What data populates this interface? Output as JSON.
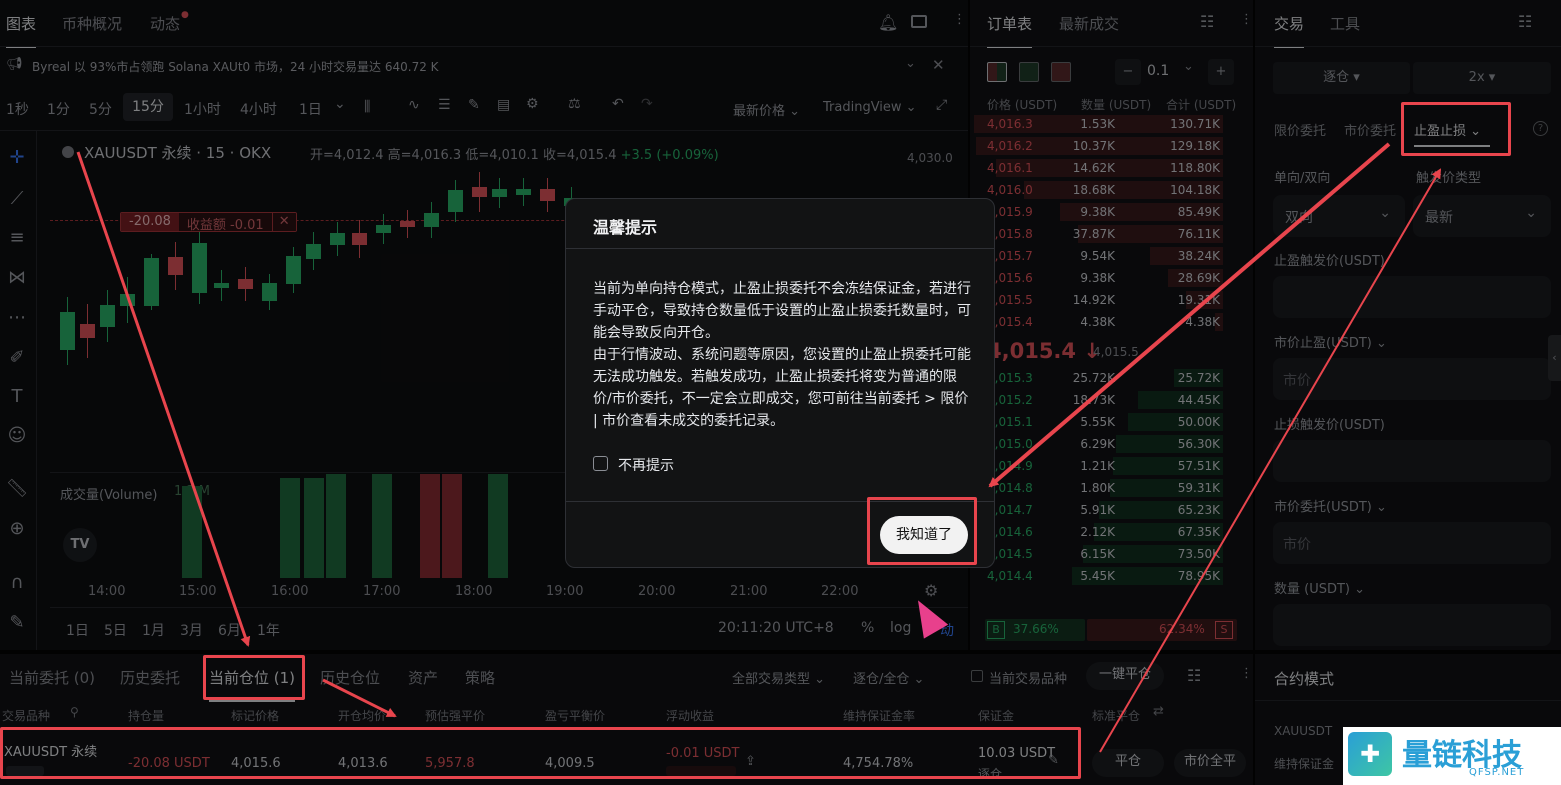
{
  "chart_panel": {
    "tabs": [
      "图表",
      "币种概况",
      "动态"
    ],
    "ticker": "Byreal 以 93%市占领跑 Solana XAUt0 市场，24 小时交易量达 640.72 K",
    "timeframes": [
      "1秒",
      "1分",
      "5分",
      "15分",
      "1小时",
      "4小时",
      "1日"
    ],
    "price_type": "最新价格",
    "provider": "TradingView",
    "symbol_line": "XAUUSDT 永续 · 15 · OKX",
    "ohlc": {
      "open": "开=4,012.4",
      "high": "高=4,016.3",
      "low": "低=4,010.1",
      "close": "收=4,015.4",
      "change": "+3.5 (+0.09%)"
    },
    "position_line": {
      "pnl": "-20.08",
      "label": "收益额 -0.01",
      "close": "✕"
    },
    "price_axis": [
      "4,030.0"
    ],
    "volume_label": "成交量(Volume)",
    "volume_value": "1.3 M",
    "time_axis": [
      "14:00",
      "15:00",
      "16:00",
      "17:00",
      "18:00",
      "19:00",
      "20:00",
      "21:00",
      "22:00"
    ],
    "ranges": [
      "1日",
      "5日",
      "1月",
      "3月",
      "6月",
      "1年"
    ],
    "clock": "20:11:20 UTC+8",
    "percent": "%",
    "log": "log",
    "auto": "动"
  },
  "orderbook": {
    "tabs": [
      "订单表",
      "最新成交"
    ],
    "precision": "0.1",
    "headers": [
      "价格 (USDT)",
      "数量 (USDT)",
      "合计 (USDT)"
    ],
    "asks": [
      [
        "4,016.3",
        "1.53K",
        "130.71K"
      ],
      [
        "4,016.2",
        "10.37K",
        "129.18K"
      ],
      [
        "4,016.1",
        "14.62K",
        "118.80K"
      ],
      [
        "4,016.0",
        "18.68K",
        "104.18K"
      ],
      [
        "4,015.9",
        "9.38K",
        "85.49K"
      ],
      [
        "4,015.8",
        "37.87K",
        "76.11K"
      ],
      [
        "4,015.7",
        "9.54K",
        "38.24K"
      ],
      [
        "4,015.6",
        "9.38K",
        "28.69K"
      ],
      [
        "4,015.5",
        "14.92K",
        "19.31K"
      ],
      [
        "4,015.4",
        "4.38K",
        "4.38K"
      ]
    ],
    "mid_price": "4,015.4 ↓",
    "mid_index": "4,015.5",
    "bids": [
      [
        "4,015.3",
        "25.72K",
        "25.72K"
      ],
      [
        "4,015.2",
        "18.73K",
        "44.45K"
      ],
      [
        "4,015.1",
        "5.55K",
        "50.00K"
      ],
      [
        "4,015.0",
        "6.29K",
        "56.30K"
      ],
      [
        "4,014.9",
        "1.21K",
        "57.51K"
      ],
      [
        "4,014.8",
        "1.80K",
        "59.31K"
      ],
      [
        "4,014.7",
        "5.91K",
        "65.23K"
      ],
      [
        "4,014.6",
        "2.12K",
        "67.35K"
      ],
      [
        "4,014.5",
        "6.15K",
        "73.50K"
      ],
      [
        "4,014.4",
        "5.45K",
        "78.95K"
      ]
    ],
    "ratio": {
      "b": "B",
      "buy": "37.66%",
      "sell": "62.34%",
      "s": "S"
    }
  },
  "trade_panel": {
    "tabs": [
      "交易",
      "工具"
    ],
    "margin_mode": "逐仓",
    "leverage": "2x",
    "order_types": [
      "限价委托",
      "市价委托",
      "止盈止损"
    ],
    "direction_label": "单向/双向",
    "trigger_type_label": "触发价类型",
    "direction_value": "双向",
    "trigger_type_value": "最新",
    "tp_trigger_label": "止盈触发价(USDT)",
    "tp_market_label": "市价止盈(USDT)",
    "tp_market_placeholder": "市价",
    "sl_trigger_label": "止损触发价(USDT)",
    "sl_market_label": "市价委托(USDT)",
    "sl_market_placeholder": "市价",
    "qty_label": "数量 (USDT)",
    "contract_mode": "合约模式",
    "contract_symbol": "XAUUSDT",
    "maint_label": "维持保证金"
  },
  "bottom": {
    "tabs": [
      "当前委托 (0)",
      "历史委托",
      "当前仓位 (1)",
      "历史仓位",
      "资产",
      "策略"
    ],
    "filter_type": "全部交易类型",
    "filter_margin": "逐仓/全仓",
    "current_only": "当前交易品种",
    "close_all": "一键平仓",
    "headers": [
      "交易品种",
      "持仓量",
      "标记价格",
      "开仓均价",
      "预估强平价",
      "盈亏平衡价",
      "浮动收益",
      "维持保证金率",
      "保证金",
      "标准平仓"
    ],
    "row": {
      "symbol": "XAUUSDT 永续",
      "size": "-20.08 USDT",
      "mark": "4,015.6",
      "entry": "4,013.6",
      "liq": "5,957.8",
      "breakeven": "4,009.5",
      "pnl": "-0.01 USDT",
      "mmr": "4,754.78%",
      "margin": "10.03 USDT",
      "margin_sub": "逐仓",
      "close": "平仓",
      "market_close": "市价全平"
    }
  },
  "modal": {
    "title": "温馨提示",
    "p1": "当前为单向持仓模式，止盈止损委托不会冻结保证金，若进行手动平仓，导致持仓数量低于设置的止盈止损委托数量时，可能会导致反向开仓。",
    "p2": "由于行情波动、系统问题等原因，您设置的止盈止损委托可能无法成功触发。若触发成功，止盈止损委托将变为普通的限价/市价委托，不一定会立即成交，您可前往当前委托 > 限价 | 市价查看未成交的委托记录。",
    "checkbox": "不再提示",
    "confirm": "我知道了"
  },
  "watermark": {
    "name": "量链科技",
    "url": "QFSP.NET"
  },
  "colors": {
    "up": "#2bb46b",
    "down": "#e2545c",
    "annotation": "#e8454d"
  }
}
